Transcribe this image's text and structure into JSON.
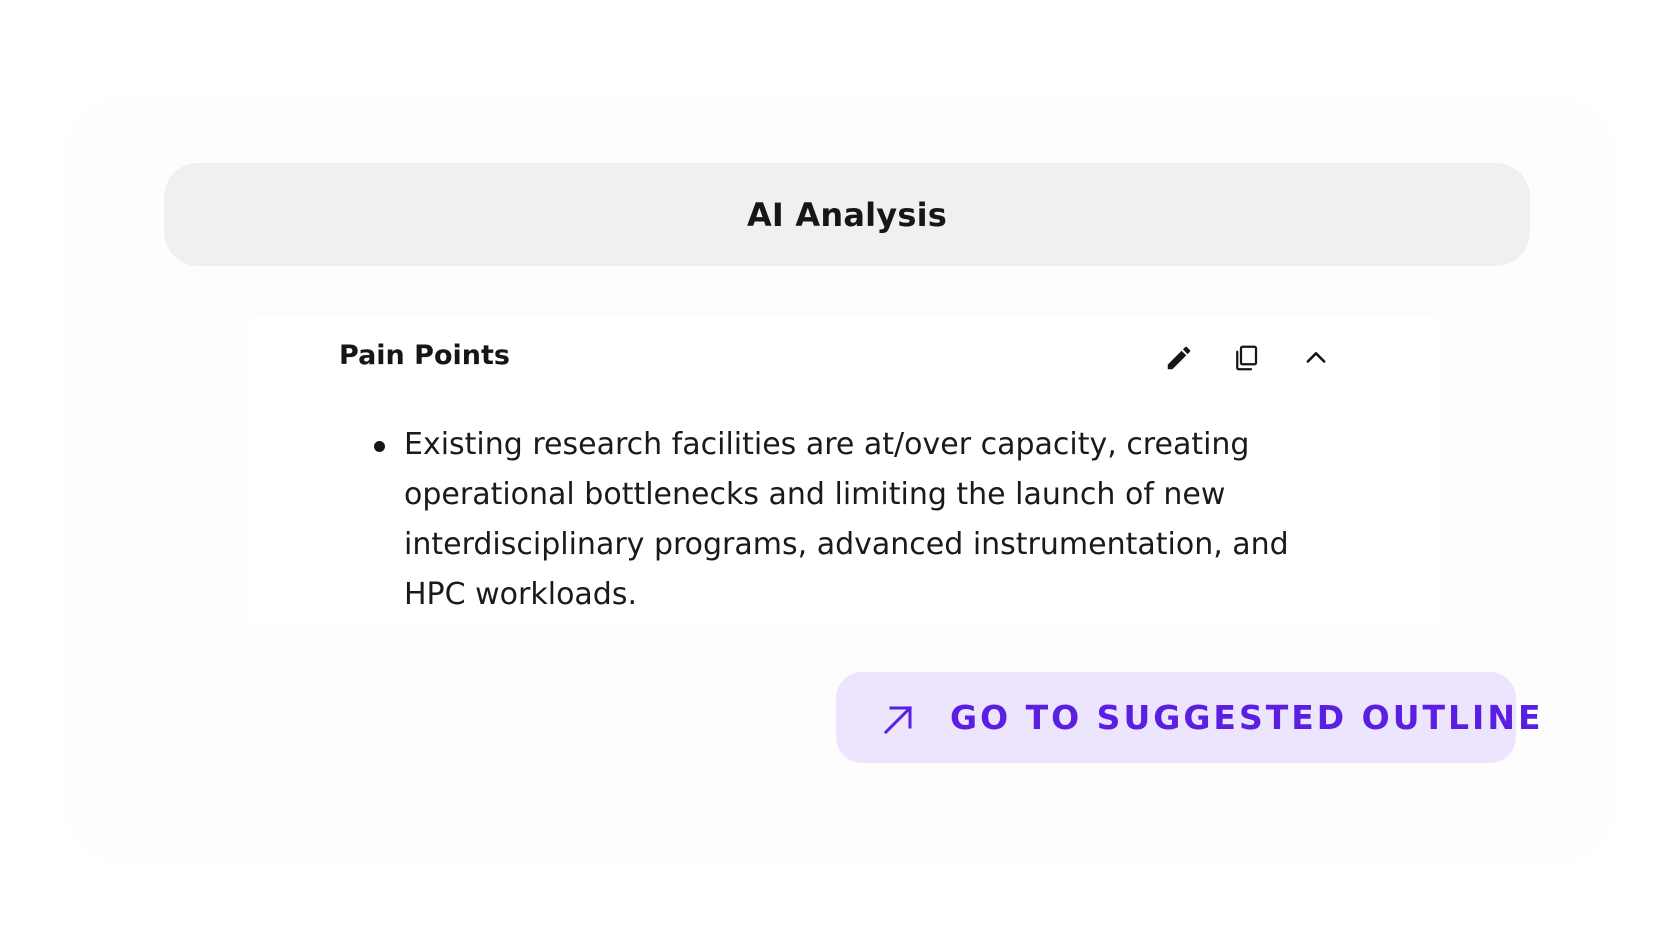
{
  "header": {
    "title": "AI Analysis"
  },
  "section": {
    "title": "Pain Points",
    "actions": [
      {
        "icon": "pencil-icon",
        "label": "edit"
      },
      {
        "icon": "copy-icon",
        "label": "copy"
      },
      {
        "icon": "chevron-up-icon",
        "label": "collapse"
      }
    ],
    "bullets": [
      "Existing research facilities are at/over capacity, creating operational bottlenecks and limiting the launch of new interdisciplinary programs, advanced instrumentation, and HPC workloads."
    ]
  },
  "cta": {
    "label": "GO TO SUGGESTED OUTLINE",
    "icon": "arrow-up-right-icon",
    "color": "#5a1fe0",
    "background": "#ede4fd"
  }
}
